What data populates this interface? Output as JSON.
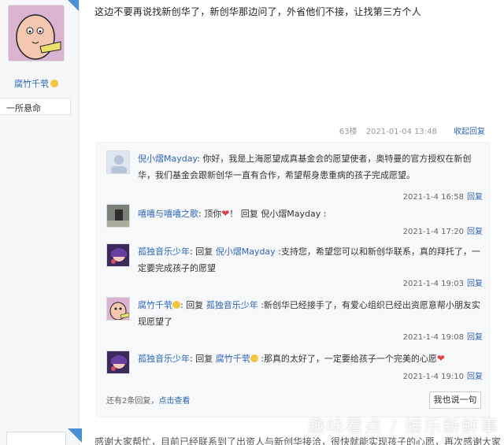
{
  "post": {
    "author_name": "腐竹千茕",
    "author_rank": "一所悬命",
    "content": "这边不要再说找新创华了，新创华那边问了，外省他们不接，让找第三方个人",
    "floor": "63楼",
    "date": "2021-01-04 13:48",
    "collapse_reply": "收起回复"
  },
  "replies": [
    {
      "user": "倪小熠Mayday",
      "separator": ": ",
      "text": "你好，我是上海愿望成真基金会的愿望使者，奥特曼的官方授权在新创华，我们基金会跟新创华一直有合作，希望帮身患重病的孩子完成愿望。",
      "time": "2021-1-4 16:58",
      "reply_label": "回复"
    },
    {
      "user": "嘻嘻与嘻嘻之歌",
      "separator": ": ",
      "text_before": "顶你",
      "text_after": "！ 回复 倪小熠Mayday :",
      "time": "2021-1-4 17:20",
      "reply_label": "回复"
    },
    {
      "user": "孤独音乐少年",
      "separator": ": ",
      "prefix": "回复 ",
      "target": "倪小熠Mayday",
      "text": " :支持您，希望您可以和新创华联系，真的拜托了，一定要完成孩子的愿望",
      "time": "2021-1-4 19:03",
      "reply_label": "回复"
    },
    {
      "user": "腐竹千茕",
      "separator": ": ",
      "prefix": "回复 ",
      "target": "孤独音乐少年",
      "text": " :新创华已经接手了，有爱心组织已经出资愿意帮小朋友实现愿望了",
      "time": "2021-1-4 19:08",
      "reply_label": "回复"
    },
    {
      "user": "孤独音乐少年",
      "separator": ": ",
      "prefix": "回复 ",
      "target": "腐竹千茕",
      "text": " :那真的太好了，一定要给孩子一个完美的心愿",
      "time": "2021-1-4 19:10",
      "reply_label": "回复"
    }
  ],
  "footer": {
    "more_text": "还有2条回复，",
    "view_link": "点击查看",
    "say_button": "我也说一句"
  },
  "bottom_text": "感谢大家帮忙，目前已经联系到了出资人与新创华接洽，很快就能实现孩子的心愿，再次感谢大家",
  "watermark": "趣味看点 / 娱乐新鲜事",
  "colors": {
    "link": "#2d64b3",
    "corner_badge": "#4b8fd4",
    "heart": "#e0454f"
  }
}
